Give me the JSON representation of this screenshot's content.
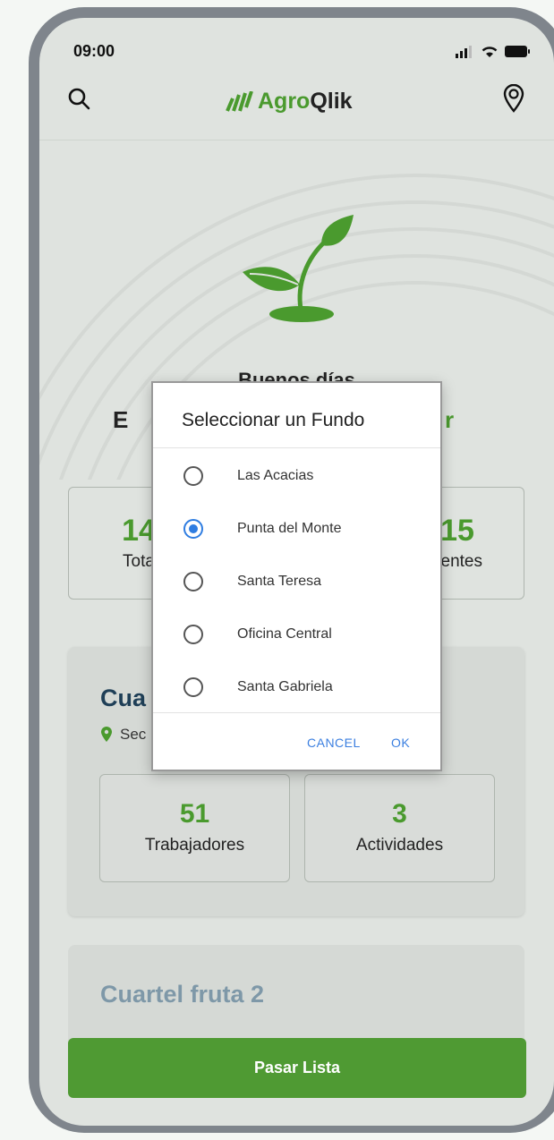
{
  "status": {
    "time": "09:00"
  },
  "header": {
    "app_name_prefix": "Agro",
    "app_name_suffix": "Qlik"
  },
  "greeting": "Buenos días",
  "welcome": {
    "prefix": "E",
    "name_suffix": "r"
  },
  "summary": {
    "left": {
      "value": "14",
      "label": "Tota"
    },
    "right": {
      "value": "15",
      "label": "sentes"
    }
  },
  "card1": {
    "title": "Cua",
    "subtitle": "Sec",
    "workers": {
      "value": "51",
      "label": "Trabajadores"
    },
    "activities": {
      "value": "3",
      "label": "Actividades"
    }
  },
  "card2": {
    "title": "Cuartel fruta 2"
  },
  "cta_label": "Pasar Lista",
  "dialog": {
    "title": "Seleccionar un Fundo",
    "options": [
      {
        "label": "Las Acacias",
        "selected": false
      },
      {
        "label": "Punta del Monte",
        "selected": true
      },
      {
        "label": "Santa Teresa",
        "selected": false
      },
      {
        "label": "Oficina Central",
        "selected": false
      },
      {
        "label": "Santa Gabriela",
        "selected": false
      }
    ],
    "cancel_label": "CANCEL",
    "ok_label": "OK"
  },
  "colors": {
    "brand_green": "#4a9a2e",
    "accent_blue": "#2f7de1",
    "title_navy": "#1f3f57"
  },
  "icons": [
    "search-icon",
    "location-pin-icon",
    "signal-icon",
    "wifi-icon",
    "battery-icon",
    "sprout-icon"
  ]
}
